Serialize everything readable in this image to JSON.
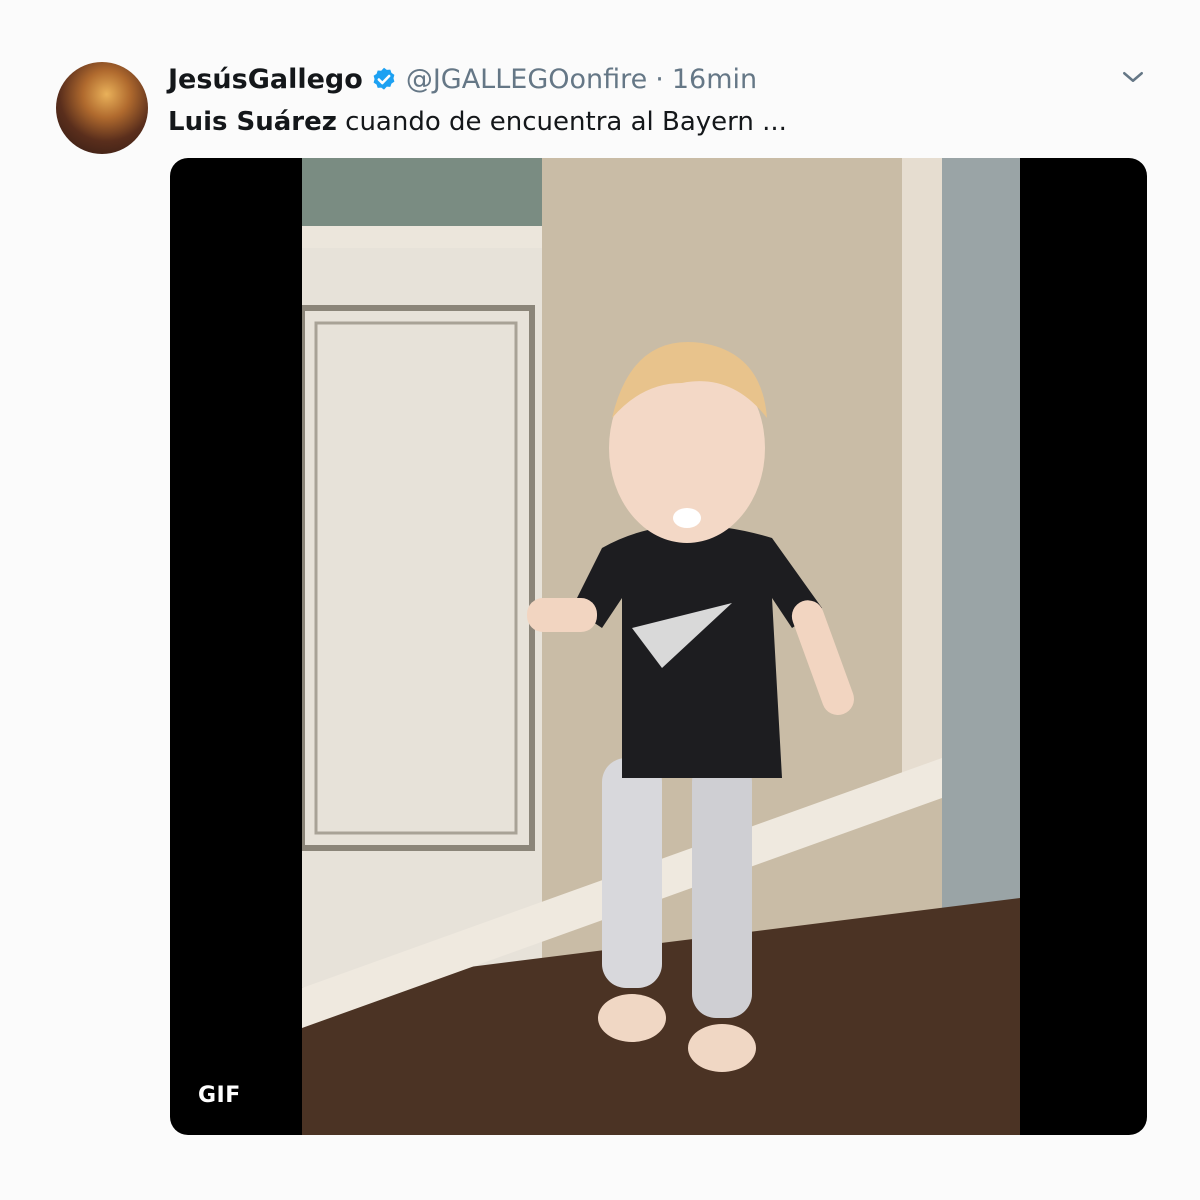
{
  "tweet": {
    "author": {
      "display_name": "JesúsGallego",
      "handle": "@JGALLEGOonfire",
      "avatar_icon": "user-avatar",
      "verified_icon": "verified-badge-icon"
    },
    "separator": "·",
    "timestamp": "16min",
    "menu_icon": "chevron-down-icon",
    "text": {
      "mention": "Luis Suárez",
      "body": " cuando de encuentra al Bayern ..."
    },
    "media": {
      "badge": "GIF"
    }
  },
  "colors": {
    "text_primary": "#14171a",
    "text_secondary": "#657786",
    "verified_blue": "#1da1f2",
    "media_background": "#000000"
  }
}
